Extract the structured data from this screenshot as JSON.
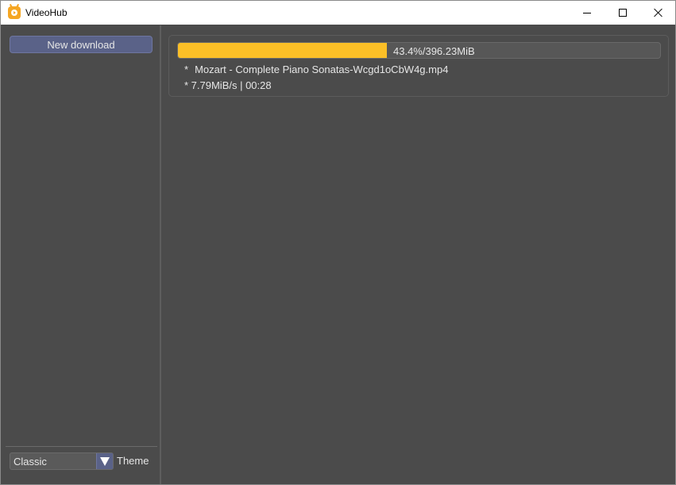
{
  "window": {
    "title": "VideoHub",
    "icon": "videohub-tv-icon",
    "controls": {
      "minimize": "minimize-icon",
      "maximize": "maximize-icon",
      "close": "close-icon"
    }
  },
  "sidebar": {
    "new_download_label": "New download",
    "theme": {
      "selected": "Classic",
      "label": "Theme",
      "arrow_icon": "triangle-down-icon"
    }
  },
  "downloads": [
    {
      "progress_fraction": 0.434,
      "progress_text": "43.4%/396.23MiB",
      "filename_bullet": "*",
      "filename": "Mozart - Complete Piano Sonatas-Wcgd1oCbW4g.mp4",
      "speed_eta": "* 7.79MiB/s | 00:28"
    }
  ],
  "colors": {
    "accent_button": "#5a6288",
    "progress_fill": "#fbbf27",
    "background": "#4b4b4b",
    "text": "#e6e6e6"
  }
}
